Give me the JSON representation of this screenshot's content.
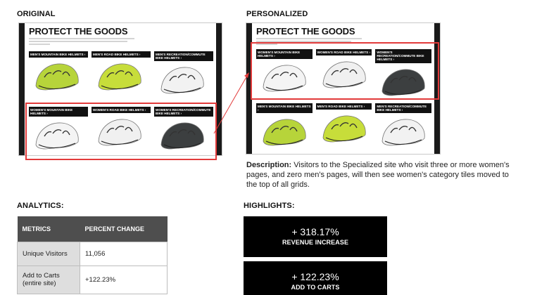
{
  "labels": {
    "original": "ORIGINAL",
    "personalized": "PERSONALIZED",
    "analytics": "ANALYTICS:",
    "highlights": "HIGHLIGHTS:"
  },
  "original_shot": {
    "title": "PROTECT THE GOODS",
    "subtitle": "From high-performance racing helmets to trusty about-towners, we have the perfect lid to improve your safety, comfort, and speed out on the road and trail.",
    "rows": [
      [
        {
          "label": "MEN'S MOUNTAIN BIKE HELMETS ›",
          "color": "#b7d43a"
        },
        {
          "label": "MEN'S ROAD BIKE HELMETS ›",
          "color": "#c7dd3a"
        },
        {
          "label": "MEN'S RECREATION/COMMUTE BIKE HELMETS ›",
          "color": "#f2f2f2"
        }
      ],
      [
        {
          "label": "WOMEN'S MOUNTAIN BIKE HELMETS ›",
          "color": "#f4f4f4"
        },
        {
          "label": "WOMEN'S ROAD BIKE HELMETS ›",
          "color": "#f0f0f0"
        },
        {
          "label": "WOMEN'S RECREATION/COMMUTE BIKE HELMETS ›",
          "color": "#3c3f40"
        }
      ]
    ]
  },
  "personalized_shot": {
    "title": "PROTECT THE GOODS",
    "subtitle": "From high-performance racing helmets to trusty about-towners, we have the perfect lid to improve your safety, comfort, and speed out on the road and trail.",
    "rows": [
      [
        {
          "label": "WOMEN'S MOUNTAIN BIKE HELMETS ›",
          "color": "#f4f4f4"
        },
        {
          "label": "WOMEN'S ROAD BIKE HELMETS ›",
          "color": "#f0f0f0"
        },
        {
          "label": "WOMEN'S RECREATION/COMMUTE BIKE HELMETS ›",
          "color": "#3c3f40"
        }
      ],
      [
        {
          "label": "MEN'S MOUNTAIN BIKE HELMETS ›",
          "color": "#b7d43a"
        },
        {
          "label": "MEN'S ROAD BIKE HELMETS ›",
          "color": "#c7dd3a"
        },
        {
          "label": "MEN'S RECREATION/COMMUTE BIKE HELMETS ›",
          "color": "#f2f2f2"
        }
      ]
    ]
  },
  "description": {
    "lead": "Description:",
    "text": " Visitors to the Specialized site who visit three or more women's pages, and zero men's pages, will then see women's category tiles moved to the top of all grids."
  },
  "analytics": {
    "headers": [
      "METRICS",
      "PERCENT CHANGE"
    ],
    "rows": [
      {
        "metric": "Unique Visitors",
        "value": "11,056"
      },
      {
        "metric": "Add to Carts (entire site)",
        "value": "+122.23%"
      }
    ]
  },
  "highlights": [
    {
      "value": "+ 318.17%",
      "label": "REVENUE INCREASE"
    },
    {
      "value": "+ 122.23%",
      "label": "ADD TO CARTS"
    }
  ],
  "colors": {
    "highlight_box": "#000000",
    "callout_red": "#e23a3a",
    "table_header": "#4e4e4e"
  }
}
